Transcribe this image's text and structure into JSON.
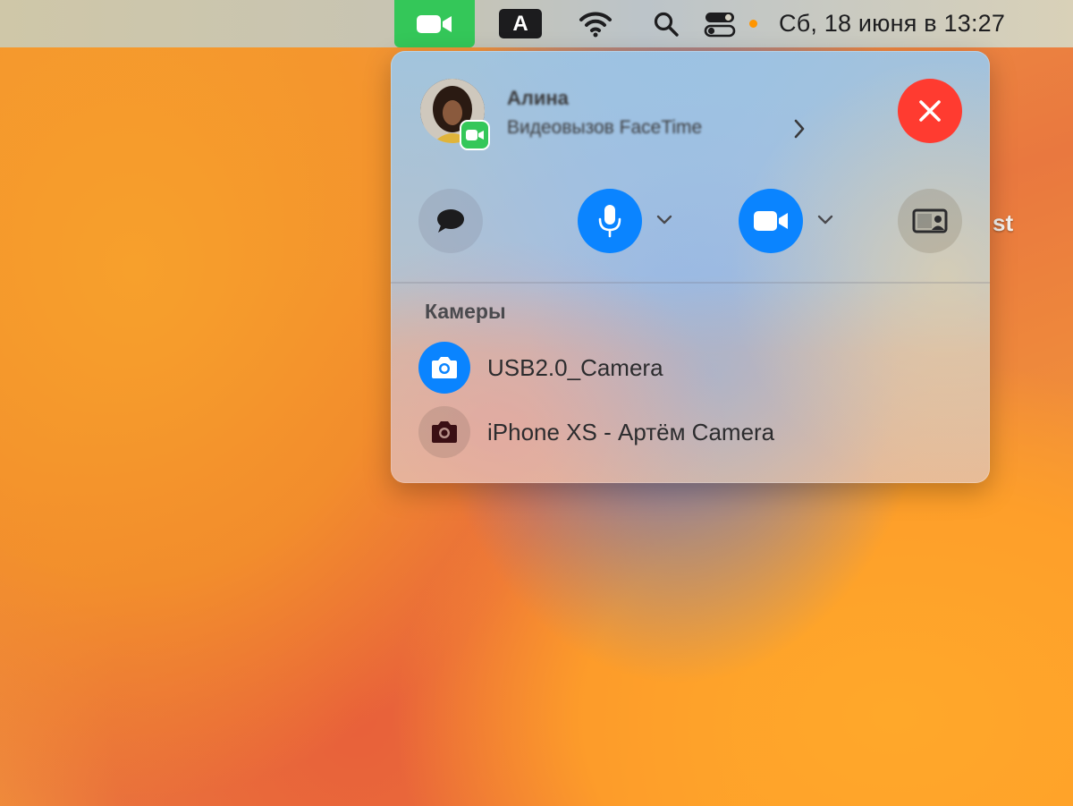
{
  "menubar": {
    "input_source_letter": "A",
    "clock": "Сб, 18 июня в 13:27",
    "facetime_icon": "video-camera-icon",
    "wifi_icon": "wifi-icon",
    "search_icon": "search-icon",
    "control_center_icon": "control-center-icon",
    "recording_indicator_color": "#ff9500"
  },
  "desktop": {
    "partial_label": "st"
  },
  "call_panel": {
    "contact_name": "Алина",
    "call_type": "Видеовызов FaceTime",
    "end_call_color": "#ff3b30",
    "controls": {
      "messages_icon": "speech-bubble-icon",
      "mic_icon": "microphone-icon",
      "video_icon": "video-camera-icon",
      "share_icon": "screen-share-icon",
      "active_color": "#0a84ff"
    },
    "cameras": {
      "title": "Камеры",
      "items": [
        {
          "label": "USB2.0_Camera",
          "selected": true
        },
        {
          "label": "iPhone XS - Артём Camera",
          "selected": false
        }
      ]
    }
  }
}
